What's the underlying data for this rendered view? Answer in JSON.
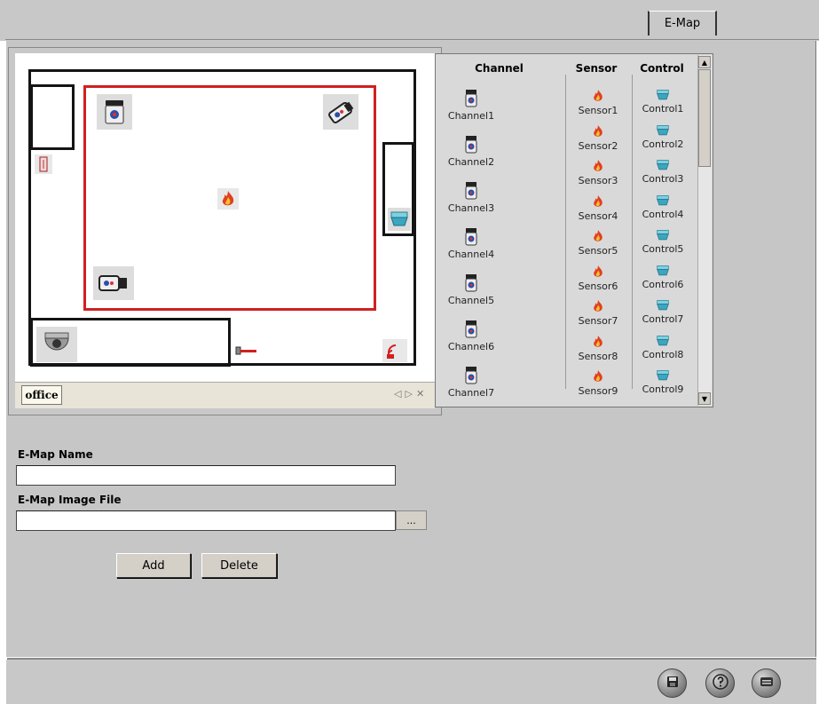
{
  "tabs": {
    "emap_label": "E-Map"
  },
  "map": {
    "sheet_tab_label": "office",
    "tab_nav": {
      "prev": "◁",
      "next": "▷",
      "close": "✕"
    }
  },
  "device_list": {
    "headers": {
      "channel": "Channel",
      "sensor": "Sensor",
      "control": "Control"
    },
    "channels": [
      "Channel1",
      "Channel2",
      "Channel3",
      "Channel4",
      "Channel5",
      "Channel6",
      "Channel7"
    ],
    "sensors": [
      "Sensor1",
      "Sensor2",
      "Sensor3",
      "Sensor4",
      "Sensor5",
      "Sensor6",
      "Sensor7",
      "Sensor8",
      "Sensor9"
    ],
    "controls": [
      "Control1",
      "Control2",
      "Control3",
      "Control4",
      "Control5",
      "Control6",
      "Control7",
      "Control8",
      "Control9"
    ],
    "scroll_up": "▲",
    "scroll_down": "▼"
  },
  "form": {
    "name_label": "E-Map Name",
    "name_value": "",
    "image_label": "E-Map Image File",
    "image_value": "",
    "browse_label": "...",
    "add_label": "Add",
    "delete_label": "Delete"
  },
  "footer": {
    "icons": [
      "save-icon",
      "help-icon",
      "exit-icon"
    ]
  },
  "colors": {
    "background": "#c6c6c6",
    "wall": "#141414",
    "zone_border": "#d02020",
    "sensor": "#e04020",
    "control": "#3aa6c0"
  }
}
